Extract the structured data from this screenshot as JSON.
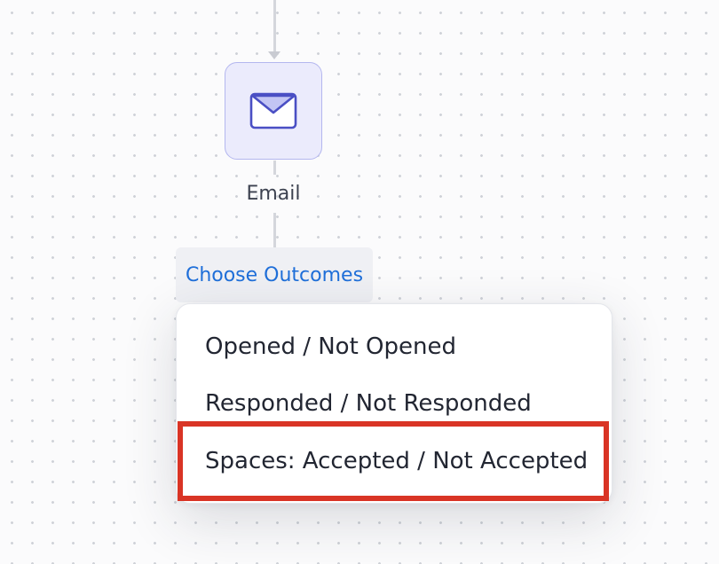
{
  "flow": {
    "node": {
      "icon": "envelope-icon",
      "label": "Email",
      "colors": {
        "background": "#ebebfc",
        "border": "#b4b7ef",
        "icon": "#4a4fc4"
      }
    },
    "choose_outcomes_label": "Choose Outcomes",
    "link_color": "#1f6fd9"
  },
  "dropdown": {
    "options": [
      {
        "label": "Opened / Not Opened"
      },
      {
        "label": "Responded / Not Responded"
      },
      {
        "label": "Spaces: Accepted / Not Accepted",
        "highlighted": true
      }
    ],
    "highlight_color": "#d93425"
  }
}
